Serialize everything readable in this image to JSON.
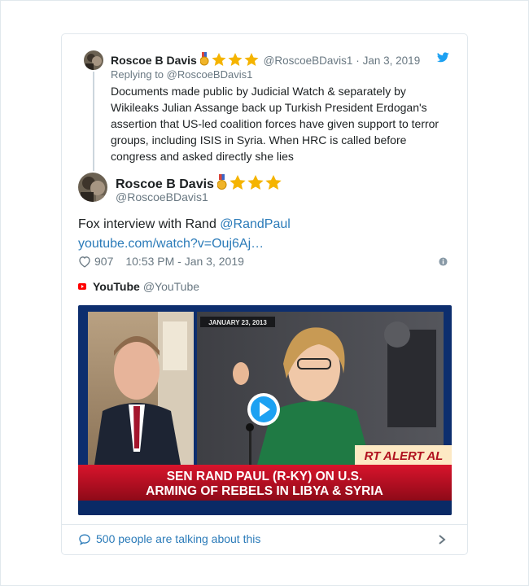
{
  "reply": {
    "author_name": "Roscoe B Davis",
    "author_handle": "@RoscoeBDavis1",
    "separator": "·",
    "date": "Jan 3, 2019",
    "replying_to": "Replying to @RoscoeBDavis1",
    "text": "Documents made public by Judicial Watch & separately by Wikileaks Julian Assange back up Turkish President Erdogan's assertion that US-led coalition forces have given support to terror groups, including ISIS in Syria. When HRC is called before congress and asked directly she lies"
  },
  "tweet": {
    "author_name": "Roscoe B Davis",
    "author_handle": "@RoscoeBDavis1",
    "text_prefix": "Fox interview with Rand ",
    "mention": "@RandPaul",
    "url_text": "youtube.com/watch?v=Ouj6Aj…",
    "likes": "907",
    "timestamp": "10:53 PM - Jan 3, 2019"
  },
  "embed": {
    "source_name": "YouTube",
    "source_handle": "@YouTube",
    "video": {
      "date_caption": "JANUARY 23, 2013",
      "alert_text": "RT ALERT AL",
      "headline_line1": "SEN RAND PAUL (R-KY) ON U.S.",
      "headline_line2": "ARMING OF REBELS IN LIBYA & SYRIA"
    }
  },
  "footer": {
    "talking_text": "500 people are talking about this"
  },
  "colors": {
    "link": "#2b7bb9",
    "muted": "#697882",
    "twitter_blue": "#1da1f2",
    "youtube_red": "#ff0000",
    "star_gold": "#f5b400",
    "news_red": "#c8102e"
  },
  "icons": [
    "twitter-bird-icon",
    "medal-icon",
    "star-icon",
    "heart-icon",
    "info-icon",
    "youtube-icon",
    "play-icon",
    "chat-bubble-icon",
    "chevron-right-icon"
  ]
}
